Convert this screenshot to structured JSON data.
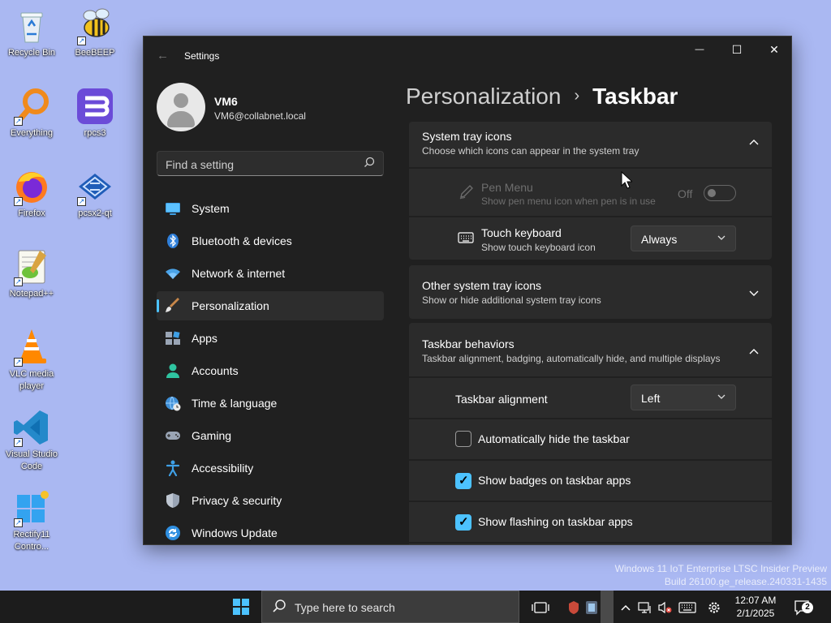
{
  "desktop": {
    "icons": [
      {
        "label": "Recycle Bin"
      },
      {
        "label": "BeeBEEP"
      },
      {
        "label": "Everything"
      },
      {
        "label": "rpcs3"
      },
      {
        "label": "Firefox"
      },
      {
        "label": "pcsx2-qt"
      },
      {
        "label": "Notepad++"
      },
      {
        "label": "VLC media player"
      },
      {
        "label": "Visual Studio Code"
      },
      {
        "label": "Rectify11 Contro..."
      }
    ],
    "watermark": {
      "line1": "Windows 11 IoT Enterprise LTSC Insider Preview",
      "line2": "Build 26100.ge_release.240331-1435"
    }
  },
  "window": {
    "title": "Settings",
    "controls": {
      "minimize": "—",
      "maximize": "☐",
      "close": "✕"
    },
    "back_icon": "←"
  },
  "profile": {
    "name": "VM6",
    "email": "VM6@collabnet.local"
  },
  "search": {
    "placeholder": "Find a setting",
    "icon": "⌕"
  },
  "nav": {
    "items": [
      {
        "label": "System",
        "icon": "monitor-icon"
      },
      {
        "label": "Bluetooth & devices",
        "icon": "bluetooth-icon"
      },
      {
        "label": "Network & internet",
        "icon": "wifi-icon"
      },
      {
        "label": "Personalization",
        "icon": "brush-icon",
        "active": true
      },
      {
        "label": "Apps",
        "icon": "apps-icon"
      },
      {
        "label": "Accounts",
        "icon": "person-icon"
      },
      {
        "label": "Time & language",
        "icon": "globe-clock-icon"
      },
      {
        "label": "Gaming",
        "icon": "controller-icon"
      },
      {
        "label": "Accessibility",
        "icon": "accessibility-icon"
      },
      {
        "label": "Privacy & security",
        "icon": "shield-icon"
      },
      {
        "label": "Windows Update",
        "icon": "update-icon"
      }
    ]
  },
  "breadcrumb": {
    "parent": "Personalization",
    "separator": "›",
    "current": "Taskbar"
  },
  "sections": {
    "system_tray": {
      "title": "System tray icons",
      "subtitle": "Choose which icons can appear in the system tray",
      "chevron": "^"
    },
    "pen_menu": {
      "title": "Pen Menu",
      "subtitle": "Show pen menu icon when pen is in use",
      "state": "Off",
      "enabled": false
    },
    "touch_keyboard": {
      "title": "Touch keyboard",
      "subtitle": "Show touch keyboard icon",
      "value": "Always"
    },
    "other_tray": {
      "title": "Other system tray icons",
      "subtitle": "Show or hide additional system tray icons",
      "chevron": "⌄"
    },
    "behaviors": {
      "title": "Taskbar behaviors",
      "subtitle": "Taskbar alignment, badging, automatically hide, and multiple displays",
      "chevron": "^"
    },
    "alignment": {
      "title": "Taskbar alignment",
      "value": "Left"
    },
    "auto_hide": {
      "label": "Automatically hide the taskbar",
      "checked": false
    },
    "badges": {
      "label": "Show badges on taskbar apps",
      "checked": true
    },
    "flashing": {
      "label": "Show flashing on taskbar apps",
      "checked": true
    }
  },
  "taskbar": {
    "search_placeholder": "Type here to search",
    "time": "12:07 AM",
    "date": "2/1/2025",
    "notification_count": "2",
    "accent": "#4cc2ff"
  }
}
